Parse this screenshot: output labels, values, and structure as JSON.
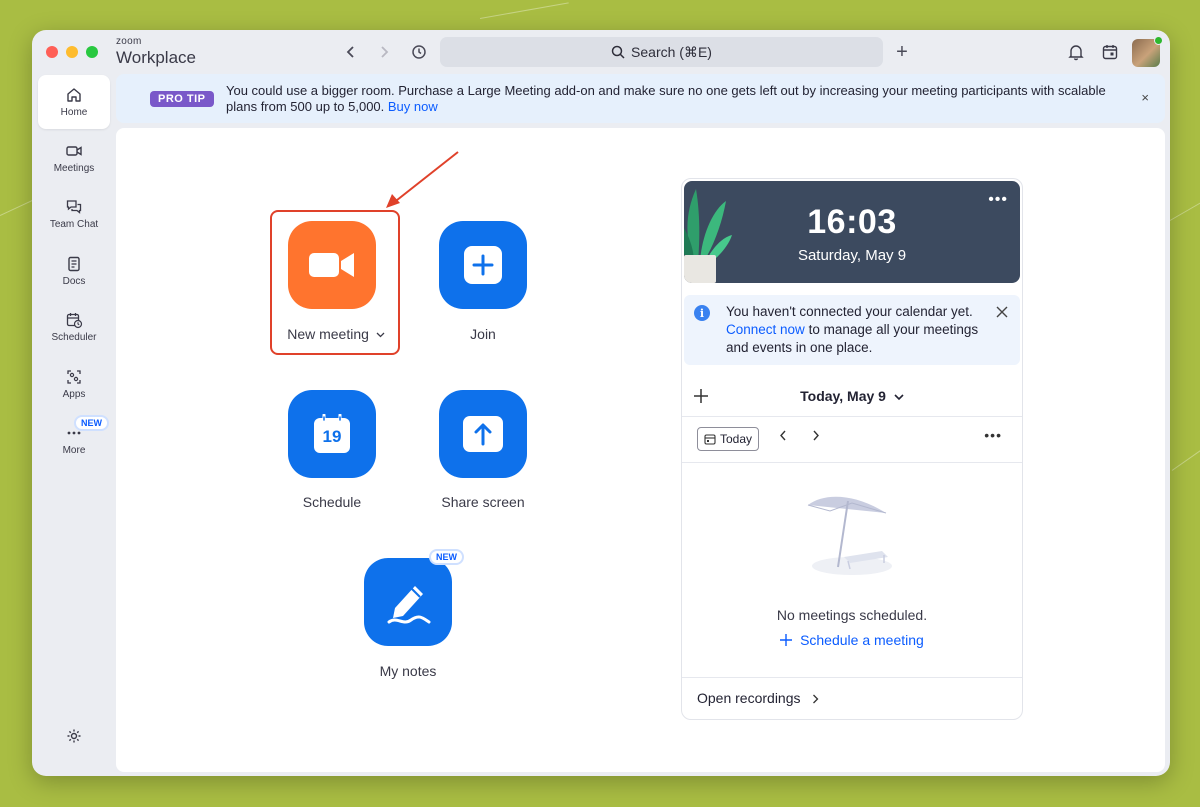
{
  "app": {
    "brand_small": "zoom",
    "brand_big": "Workplace"
  },
  "titlebar": {
    "search_label": "Search (⌘E)",
    "plus_label": "+"
  },
  "sidebar": {
    "items": [
      {
        "label": "Home",
        "icon": "home-icon",
        "active": true
      },
      {
        "label": "Meetings",
        "icon": "video-camera-icon"
      },
      {
        "label": "Team Chat",
        "icon": "chat-bubbles-icon"
      },
      {
        "label": "Docs",
        "icon": "document-icon"
      },
      {
        "label": "Scheduler",
        "icon": "calendar-clock-icon"
      },
      {
        "label": "Apps",
        "icon": "apps-grid-icon"
      },
      {
        "label": "More",
        "icon": "more-dots-icon",
        "badge": "NEW"
      }
    ]
  },
  "protip": {
    "badge": "PRO TIP",
    "text": "You could use a bigger room. Purchase a Large Meeting add-on and make sure no one gets left out by increasing your meeting participants with scalable plans from 500 up to 5,000. ",
    "link": "Buy now",
    "close": "×"
  },
  "actions": {
    "new_meeting": "New meeting",
    "join": "Join",
    "schedule": "Schedule",
    "schedule_day": "19",
    "share_screen": "Share screen",
    "my_notes": "My notes",
    "my_notes_badge": "NEW"
  },
  "calendar": {
    "time": "16:03",
    "date": "Saturday, May 9",
    "notice_pre": "You haven't connected your calendar yet. ",
    "notice_link": "Connect now",
    "notice_post": " to manage all your meetings and events in one place.",
    "day_title": "Today, May 9",
    "today_button": "Today",
    "empty_text": "No meetings scheduled.",
    "schedule_link": "Schedule a meeting",
    "open_recordings": "Open recordings"
  },
  "colors": {
    "accent_blue": "#0e71eb",
    "accent_orange": "#ff742e",
    "highlight_red": "#e0412a",
    "header_slate": "#3c4a5f"
  }
}
